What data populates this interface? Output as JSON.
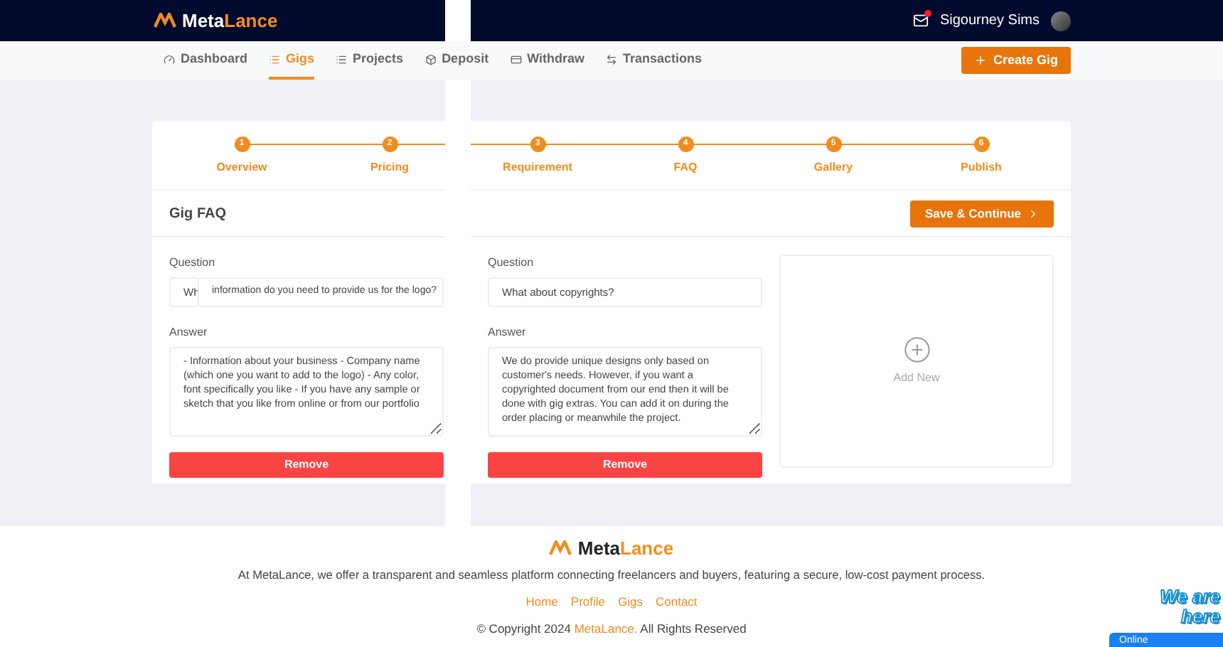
{
  "header": {
    "brand_left": "Meta",
    "brand_right": "Lance",
    "user_name": "Sigourney Sims",
    "has_notification": true
  },
  "nav": {
    "items": [
      {
        "label": "Dashboard",
        "selected": false
      },
      {
        "label": "Gigs",
        "selected": true
      },
      {
        "label": "Projects",
        "selected": false
      },
      {
        "label": "Deposit",
        "selected": false
      },
      {
        "label": "Withdraw",
        "selected": false
      },
      {
        "label": "Transactions",
        "selected": false
      }
    ],
    "create_button": "Create Gig"
  },
  "steps": [
    {
      "number": "1",
      "label": "Overview"
    },
    {
      "number": "2",
      "label": "Pricing"
    },
    {
      "number": "3",
      "label": "Requirement"
    },
    {
      "number": "4",
      "label": "FAQ"
    },
    {
      "number": "5",
      "label": "Gallery"
    },
    {
      "number": "6",
      "label": "Publish"
    }
  ],
  "section": {
    "title": "Gig FAQ",
    "save_button": "Save & Continue"
  },
  "faqs": [
    {
      "question_label": "Question",
      "question": "Wh",
      "overlay_text": "information do you need to provide us for the logo?",
      "answer_label": "Answer",
      "answer": "- Information about your business - Company name (which one you want to add to the logo) - Any color, font specifically you like - If you have any sample or sketch that you like from online or from our portfolio",
      "remove_button": "Remove"
    },
    {
      "question_label": "Question",
      "question": "What about copyrights?",
      "answer_label": "Answer",
      "answer": "We do provide unique designs only based on customer's needs. However, if you want a copyrighted document from our end then it will be done with gig extras. You can add it on during the order placing or meanwhile the project.",
      "remove_button": "Remove"
    }
  ],
  "add_new": "Add New",
  "footer": {
    "brand_left": "Meta",
    "brand_right": "Lance",
    "text": "At MetaLance, we offer a transparent and seamless platform connecting freelancers and buyers, featuring a secure, low-cost payment process.",
    "links": [
      "Home",
      "Profile",
      "Gigs",
      "Contact"
    ],
    "copyright_before": "© Copyright 2024",
    "copyright_brand": "MetaLance.",
    "copyright_after": "All Rights Reserved"
  },
  "chat_widget": {
    "title": "We are here",
    "status": "Online"
  }
}
